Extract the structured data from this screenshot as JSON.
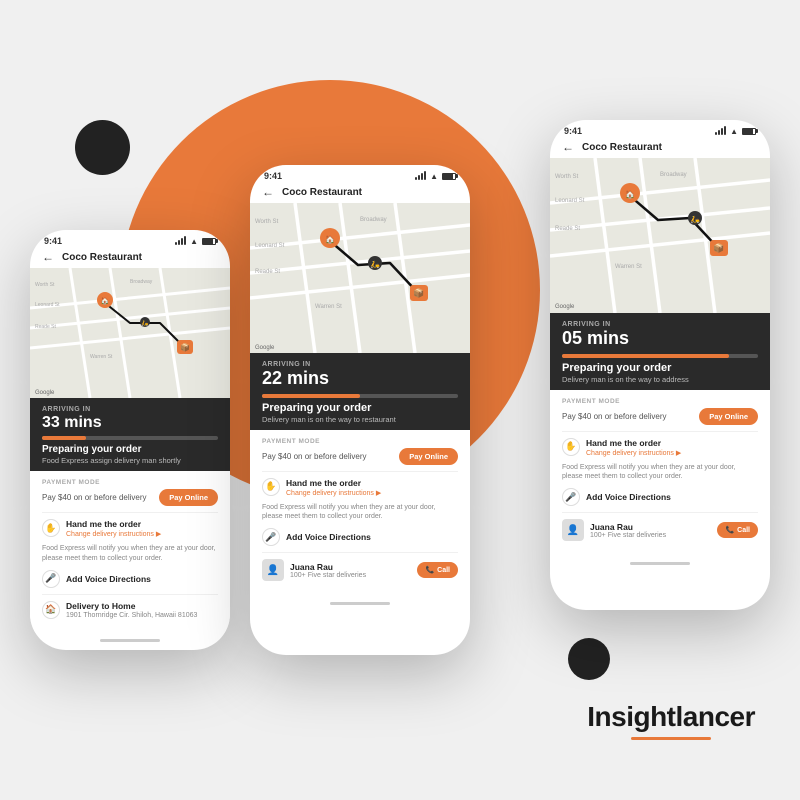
{
  "brand": {
    "name": "Insightlancer"
  },
  "phone_left": {
    "status_time": "9:41",
    "header_title": "Coco Restaurant",
    "arriving_label": "ARRIVING IN",
    "arriving_time": "33 mins",
    "progress_percent": 25,
    "order_status": "Preparing your order",
    "order_sub": "Food Express assign delivery man shortly",
    "payment_label": "PAYMENT MODE",
    "payment_text": "Pay $40 on or before delivery",
    "pay_btn": "Pay Online",
    "hand_me_title": "Hand me the order",
    "hand_me_sub": "Change delivery instructions ▶",
    "notify_text": "Food Express will notify you when they are at your door, please meet them to collect your order.",
    "voice_title": "Add Voice Directions",
    "delivery_home_title": "Delivery to Home",
    "delivery_home_sub": "1901 Thornridge Cir. Shiloh, Hawaii 81063"
  },
  "phone_center": {
    "status_time": "9:41",
    "header_title": "Coco Restaurant",
    "arriving_label": "ARRIVING IN",
    "arriving_time": "22 mins",
    "progress_percent": 50,
    "order_status": "Preparing your order",
    "order_sub": "Delivery man is on the way to restaurant",
    "payment_label": "PAYMENT MODE",
    "payment_text": "Pay $40 on or before delivery",
    "pay_btn": "Pay Online",
    "hand_me_title": "Hand me the order",
    "hand_me_sub": "Change delivery instructions ▶",
    "notify_text": "Food Express will notify you when they are at your door, please meet them to collect your order.",
    "voice_title": "Add Voice Directions",
    "driver_name": "Juana Rau",
    "driver_stars": "100+ Five star deliveries",
    "call_btn": "Call"
  },
  "phone_right": {
    "status_time": "9:41",
    "header_title": "Coco Restaurant",
    "arriving_label": "ARRIVING IN",
    "arriving_time": "05 mins",
    "progress_percent": 85,
    "order_status": "Preparing your order",
    "order_sub": "Delivery man is on the way to address",
    "payment_label": "PAYMENT MODE",
    "payment_text": "Pay $40 on or before delivery",
    "pay_btn": "Pay Online",
    "hand_me_title": "Hand me the order",
    "hand_me_sub": "Change delivery instructions ▶",
    "notify_text": "Food Express will notify you when they are at your door, please meet them to collect your order.",
    "voice_title": "Add Voice Directions",
    "driver_name": "Juana Rau",
    "driver_stars": "100+ Five star deliveries",
    "call_btn": "Call"
  },
  "colors": {
    "orange": "#E8793A",
    "dark": "#2a2a2a",
    "bg": "#f0f0f0"
  }
}
